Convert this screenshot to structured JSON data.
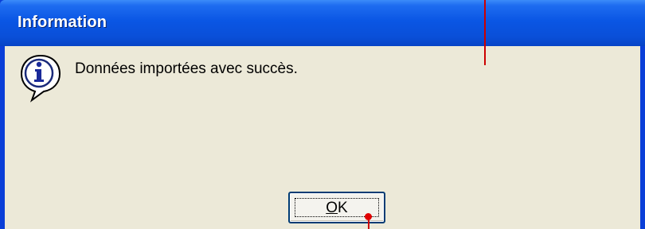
{
  "window": {
    "title": "Information"
  },
  "dialog": {
    "icon": "information-icon",
    "message": "Données importées avec succès."
  },
  "buttons": {
    "ok_mnemonic": "O",
    "ok_rest": "K"
  },
  "colors": {
    "titlebar": "#0a56e4",
    "dialog_background": "#ece9d8",
    "frame": "#0a3fd8",
    "annotation_marker": "#cc0000"
  }
}
